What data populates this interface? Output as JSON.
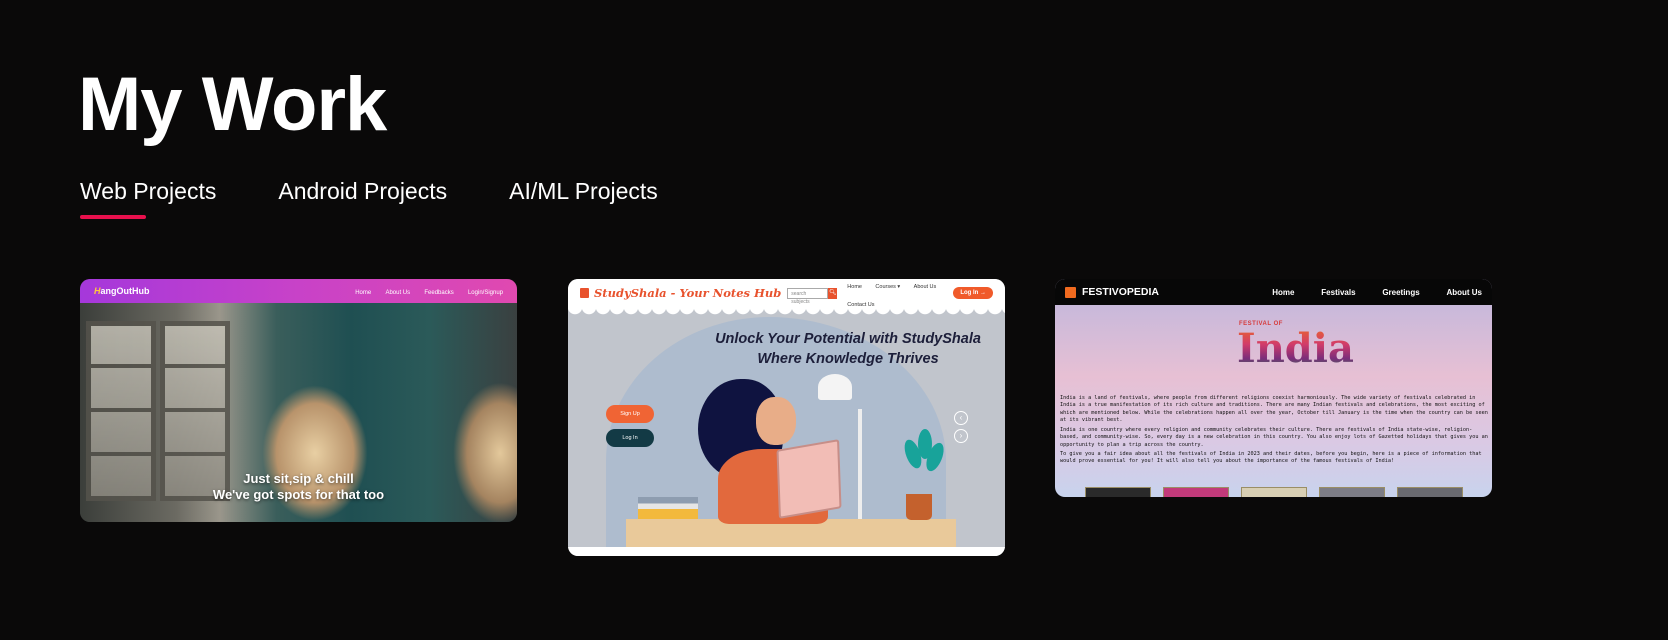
{
  "page": {
    "title": "My Work",
    "tabs": [
      {
        "label": "Web Projects",
        "active": true
      },
      {
        "label": "Android Projects",
        "active": false
      },
      {
        "label": "AI/ML Projects",
        "active": false
      }
    ],
    "accent_color": "#e8104d",
    "background_color": "#0a0909"
  },
  "projects": {
    "hangouthub": {
      "logo_initial": "H",
      "logo_rest": "angOutHub",
      "nav": [
        "Home",
        "About Us",
        "Feedbacks",
        "Login/Signup"
      ],
      "hero_line1": "Just sit,sip & chill",
      "hero_line2": "We've got spots for that too"
    },
    "studyshala": {
      "logo": "StudyShala - Your Notes Hub",
      "search_placeholder": "search subjects",
      "nav": [
        "Home",
        "Courses ▾",
        "About Us",
        "Contact Us"
      ],
      "login": "Log In",
      "headline_line1": "Unlock Your Potential with StudyShala",
      "headline_line2": "Where Knowledge Thrives",
      "signup_button": "Sign Up",
      "login_button": "Log In"
    },
    "festivopedia": {
      "logo": "FESTIVOPEDIA",
      "nav": [
        "Home",
        "Festivals",
        "Greetings",
        "About Us"
      ],
      "banner_small": "FESTIVAL OF",
      "banner_big": "India",
      "para1": "India is a land of festivals, where people from different religions coexist harmoniously. The wide variety of festivals celebrated in India is a true manifestation of its rich culture and traditions. There are many Indian festivals and celebrations, the most exciting of which are mentioned below. While the celebrations happen all over the year, October till January is the time when the country can be seen at its vibrant best.",
      "para2": "India is one country where every religion and community celebrates their culture. There are festivals of India state-wise, religion-based, and community-wise. So, every day is a new celebration in this country. You also enjoy lots of Gazetted holidays that gives you an opportunity to plan a trip across the country.",
      "para3": "To give you a fair idea about all the festivals of India in 2023 and their dates, before you begin, here is a piece of information that would prove essential for you! It will also tell you about the importance of the famous festivals of India!"
    }
  }
}
